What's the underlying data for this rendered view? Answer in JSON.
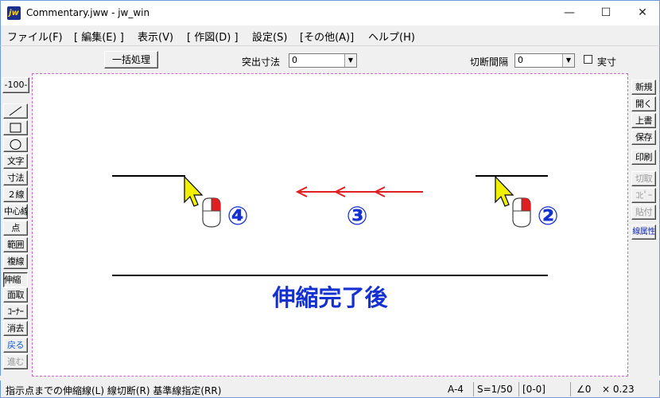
{
  "window": {
    "app_icon": "jw",
    "title": "Commentary.jww - jw_win",
    "minimize": "—",
    "maximize": "☐",
    "close": "✕"
  },
  "menu": [
    "ファイル(F)",
    "[ 編集(E) ]",
    "表示(V)",
    "[ 作図(D) ]",
    "設定(S)",
    "[その他(A)]",
    "ヘルプ(H)"
  ],
  "toolbar": {
    "batch_button": "一括処理",
    "protrude_label": "突出寸法",
    "protrude_value": "0",
    "cut_interval_label": "切断間隔",
    "cut_interval_value": "0",
    "actual_label": "実寸"
  },
  "left_tools": {
    "scale": "-100-",
    "line_icon": "line-icon",
    "rect_icon": "rectangle-icon",
    "circle_icon": "circle-icon",
    "items": [
      "文字",
      "寸法",
      "２線",
      "中心線",
      "点",
      "範囲",
      "複線",
      "伸縮",
      "面取",
      "ｺｰﾅｰ",
      "消去",
      "戻る",
      "進む"
    ]
  },
  "right_tools": [
    "新規",
    "開く",
    "上書",
    "保存",
    "印刷",
    "切取",
    "ｺﾋﾟｰ",
    "貼付",
    "線属性"
  ],
  "canvas": {
    "step2": "②",
    "step3": "③",
    "step4": "④",
    "caption": "伸縮完了後",
    "colors": {
      "arrow": "#e02020",
      "annotation": "#1530d0",
      "cursor": "#f0f000",
      "mouse_button": "#e02020"
    }
  },
  "status": {
    "message": "指示点までの伸縮線(L) 線切断(R) 基準線指定(RR)",
    "paper": "A-4",
    "scale": "S=1/50",
    "layer": "[0-0]",
    "angle": "∠0",
    "factor": "× 0.23"
  }
}
